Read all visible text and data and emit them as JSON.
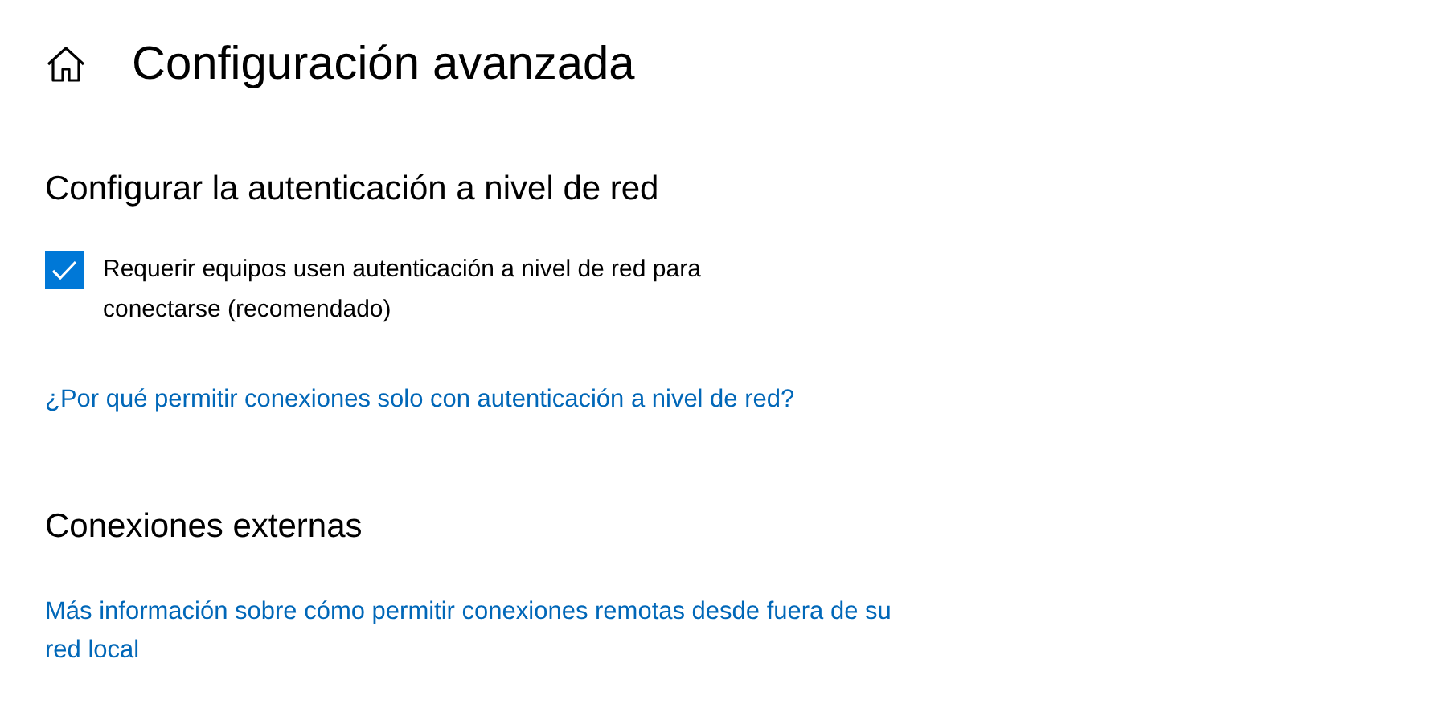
{
  "page": {
    "title": "Configuración avanzada"
  },
  "sections": [
    {
      "heading": "Configurar la autenticación a nivel de red",
      "checkbox": {
        "label": "Requerir equipos usen autenticación a nivel de red para conectarse (recomendado)",
        "checked": true
      },
      "link": "¿Por qué permitir conexiones solo con autenticación a nivel de red?"
    },
    {
      "heading": "Conexiones externas",
      "link": "Más información sobre cómo permitir conexiones remotas desde fuera de su red local"
    }
  ]
}
